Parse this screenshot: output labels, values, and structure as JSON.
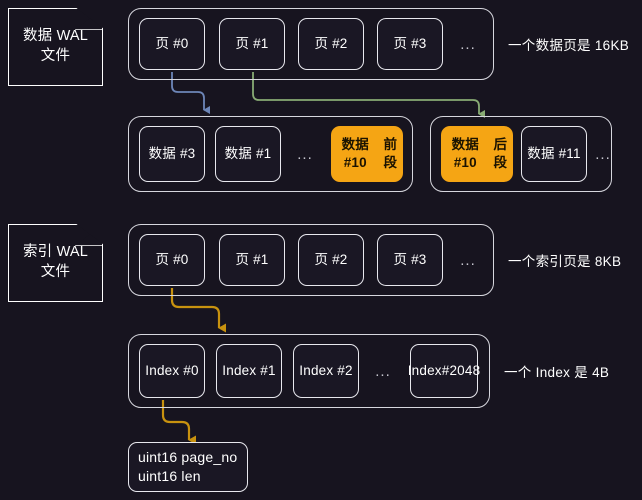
{
  "diagram": {
    "title": "WAL file page and index layout",
    "background_color": "#17141f",
    "highlight_color": "#f5a514",
    "border_color": "#e8e8ee"
  },
  "files": {
    "data_wal": "数据 WAL\n文件",
    "data_wal_line1": "数据 WAL",
    "data_wal_line2": "文件",
    "index_wal_line1": "索引 WAL",
    "index_wal_line2": "文件"
  },
  "rows": {
    "data_pages": {
      "cells": [
        {
          "label": "页 #0"
        },
        {
          "label": "页 #1"
        },
        {
          "label": "页 #2"
        },
        {
          "label": "页 #3"
        }
      ],
      "ellipsis": "...",
      "note": "一个数据页是 16KB"
    },
    "data_records_left": {
      "cells": [
        {
          "label": "数据 #3",
          "highlight": false
        },
        {
          "label": "数据 #1",
          "highlight": false
        }
      ],
      "ellipsis": "...",
      "highlighted": {
        "line1": "数据 #10",
        "line2": "前段"
      }
    },
    "data_records_right": {
      "highlighted": {
        "line1": "数据 #10",
        "line2": "后段"
      },
      "cells": [
        {
          "label": "数据 #11",
          "highlight": false
        }
      ],
      "ellipsis": "..."
    },
    "index_pages": {
      "cells": [
        {
          "label": "页 #0"
        },
        {
          "label": "页 #1"
        },
        {
          "label": "页 #2"
        },
        {
          "label": "页 #3"
        }
      ],
      "ellipsis": "...",
      "note": "一个索引页是 8KB"
    },
    "index_entries": {
      "cells": [
        {
          "label": "Index #0"
        },
        {
          "label": "Index #1"
        },
        {
          "label": "Index #2"
        }
      ],
      "ellipsis": "...",
      "last": {
        "line1": "Index",
        "line2": "#2048"
      },
      "note": "一个 Index 是 4B"
    },
    "index_struct": {
      "line1": "uint16 page_no",
      "line2": "uint16 len"
    }
  },
  "arrows": [
    {
      "name": "page0-to-data-record",
      "color": "#6d86b8"
    },
    {
      "name": "page1-to-data-record",
      "color": "#88ab74"
    },
    {
      "name": "index-page0-to-index-entry",
      "color": "#c8920f"
    },
    {
      "name": "index0-to-struct",
      "color": "#c8920f"
    }
  ]
}
